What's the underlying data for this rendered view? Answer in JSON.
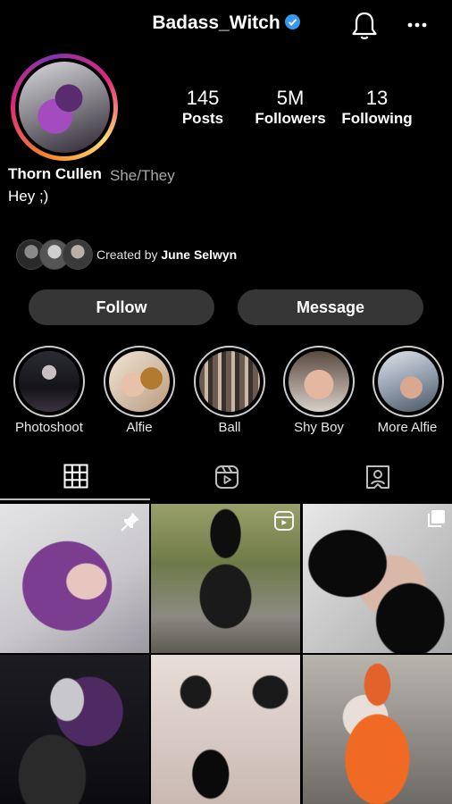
{
  "header": {
    "username": "Badass_Witch",
    "verified_icon": "verified-badge-icon",
    "bell_icon": "bell-icon",
    "more_icon": "more-horizontal-icon"
  },
  "profile": {
    "stats": [
      {
        "value": "145",
        "label": "Posts"
      },
      {
        "value": "5M",
        "label": "Followers"
      },
      {
        "value": "13",
        "label": "Following"
      }
    ],
    "name": "Thorn Cullen",
    "pronouns": "She/They",
    "bio": "Hey ;)",
    "created_by_prefix": "Created by",
    "created_by_name": "June Selwyn"
  },
  "actions": {
    "follow_label": "Follow",
    "message_label": "Message"
  },
  "highlights": [
    {
      "label": "Photoshoot"
    },
    {
      "label": "Alfie"
    },
    {
      "label": "Ball"
    },
    {
      "label": "Shy Boy"
    },
    {
      "label": "More Alfie"
    }
  ],
  "tabs": [
    {
      "icon": "grid-icon",
      "active": true
    },
    {
      "icon": "reels-icon",
      "active": false
    },
    {
      "icon": "tagged-icon",
      "active": false
    }
  ],
  "colors": {
    "background": "#000000",
    "button": "#363636",
    "verified": "#3897f0",
    "secondary_text": "#a8a8a8"
  },
  "grid_icons": {
    "pinned": "pin-icon",
    "reel": "reel-play-icon",
    "carousel": "carousel-icon"
  }
}
